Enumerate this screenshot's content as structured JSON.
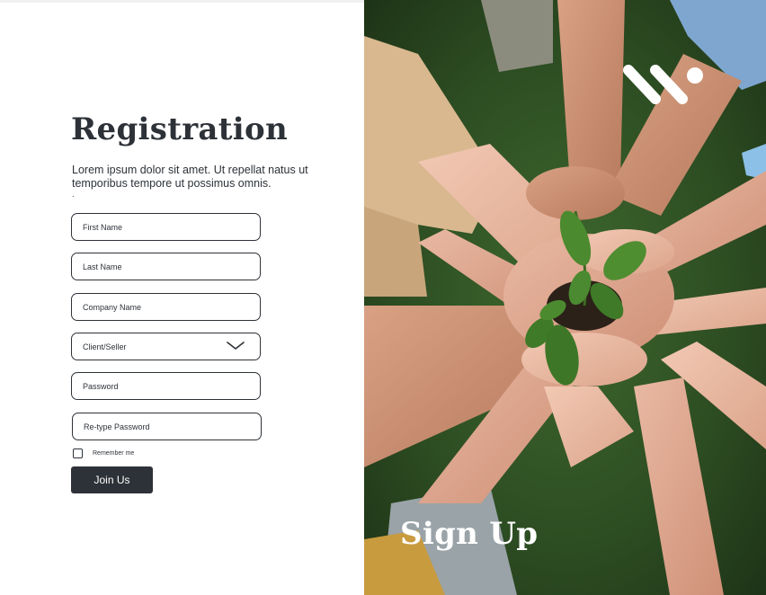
{
  "form": {
    "title": "Registration",
    "description": "Lorem ipsum dolor sit amet. Ut repellat natus ut temporibus tempore ut possimus omnis.",
    "description_dot": ".",
    "first_name_placeholder": "First Name",
    "last_name_placeholder": "Last Name",
    "company_name_placeholder": "Company Name",
    "role_select_value": "Client/Seller",
    "password_placeholder": "Password",
    "retype_password_placeholder": "Re-type Password",
    "remember_label": "Remember me",
    "remember_checked": false,
    "submit_label": "Join Us"
  },
  "hero": {
    "heading": "Sign Up",
    "logo_icon": "w-logo-icon",
    "image_subject": "hands-holding-seedling-photo"
  },
  "colors": {
    "primary_dark": "#2d3238",
    "background": "#ffffff",
    "hero_text": "#ffffff"
  }
}
